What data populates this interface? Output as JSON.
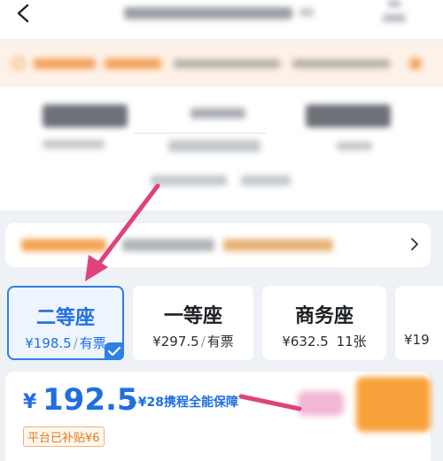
{
  "seats": [
    {
      "name": "二等座",
      "price": "¥198.5",
      "availability": "有票",
      "selected": true
    },
    {
      "name": "一等座",
      "price": "¥297.5",
      "availability": "有票",
      "selected": false
    },
    {
      "name": "商务座",
      "price": "¥632.5",
      "availability": "11张",
      "selected": false
    },
    {
      "name": "",
      "price": "¥19",
      "availability": "",
      "selected": false
    }
  ],
  "price_panel": {
    "currency": "¥",
    "price": "192.5",
    "addon": "+¥28携程全能保障",
    "subsidy": "平台已补贴¥6"
  },
  "colors": {
    "accent": "#2f7fe6",
    "annotation_arrow": "#e0427e",
    "cta": "#f8a13a",
    "notice_bg": "#fdf1e8"
  },
  "icons": {
    "back": "back-arrow-icon",
    "chevron": "chevron-right-icon",
    "selected": "check-icon",
    "notice": "info-icon"
  }
}
